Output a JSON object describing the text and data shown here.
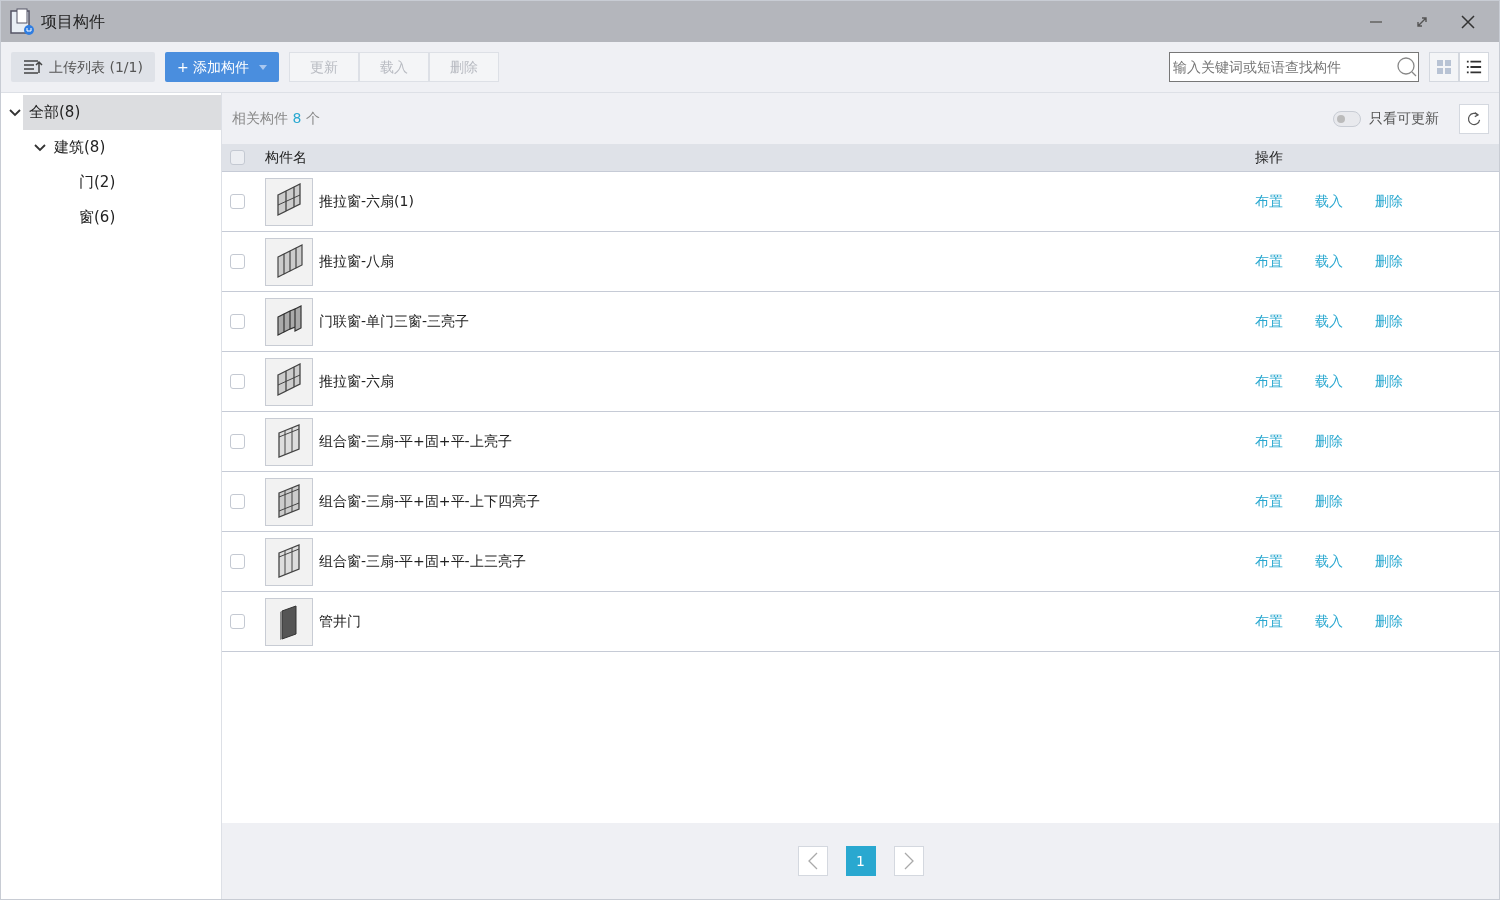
{
  "window": {
    "title": "项目构件"
  },
  "toolbar": {
    "upload_list": "上传列表 (1/1)",
    "add_button": "+ 添加构件",
    "actions": [
      {
        "label": "更新",
        "disabled": true
      },
      {
        "label": "载入",
        "disabled": true
      },
      {
        "label": "删除",
        "disabled": true
      }
    ],
    "search": {
      "placeholder": "输入关键词或短语查找构件"
    },
    "views": [
      {
        "kind": "grid",
        "selected": false
      },
      {
        "kind": "list",
        "selected": true
      }
    ]
  },
  "tree": [
    {
      "label": "全部(8)",
      "selected": true,
      "expanded": true,
      "children": [
        {
          "label": "建筑(8)",
          "selected": false,
          "expanded": true,
          "children": [
            {
              "label": "门(2)",
              "selected": false
            },
            {
              "label": "窗(6)",
              "selected": false
            }
          ]
        }
      ]
    }
  ],
  "summary": {
    "prefix": "相关构件",
    "count": "8",
    "suffix": "个",
    "filter": {
      "label": "只看可更新",
      "on": false
    }
  },
  "table": {
    "columns": [
      "构件名",
      "操作"
    ],
    "all_checked": false,
    "rows": [
      {
        "name": "推拉窗-六扇(1)",
        "checked": false,
        "actions": [
          "布置",
          "载入",
          "删除"
        ]
      },
      {
        "name": "推拉窗-八扇",
        "checked": false,
        "actions": [
          "布置",
          "载入",
          "删除"
        ]
      },
      {
        "name": "门联窗-单门三窗-三亮子",
        "checked": false,
        "actions": [
          "布置",
          "载入",
          "删除"
        ]
      },
      {
        "name": "推拉窗-六扇",
        "checked": false,
        "actions": [
          "布置",
          "载入",
          "删除"
        ]
      },
      {
        "name": "组合窗-三扇-平+固+平-上亮子",
        "checked": false,
        "actions": [
          "布置",
          "删除"
        ]
      },
      {
        "name": "组合窗-三扇-平+固+平-上下四亮子",
        "checked": false,
        "actions": [
          "布置",
          "删除"
        ]
      },
      {
        "name": "组合窗-三扇-平+固+平-上三亮子",
        "checked": false,
        "actions": [
          "布置",
          "载入",
          "删除"
        ]
      },
      {
        "name": "管井门",
        "checked": false,
        "actions": [
          "布置",
          "载入",
          "删除"
        ]
      }
    ]
  },
  "pagination": {
    "pages": [
      {
        "label": "1",
        "selected": true
      }
    ]
  }
}
